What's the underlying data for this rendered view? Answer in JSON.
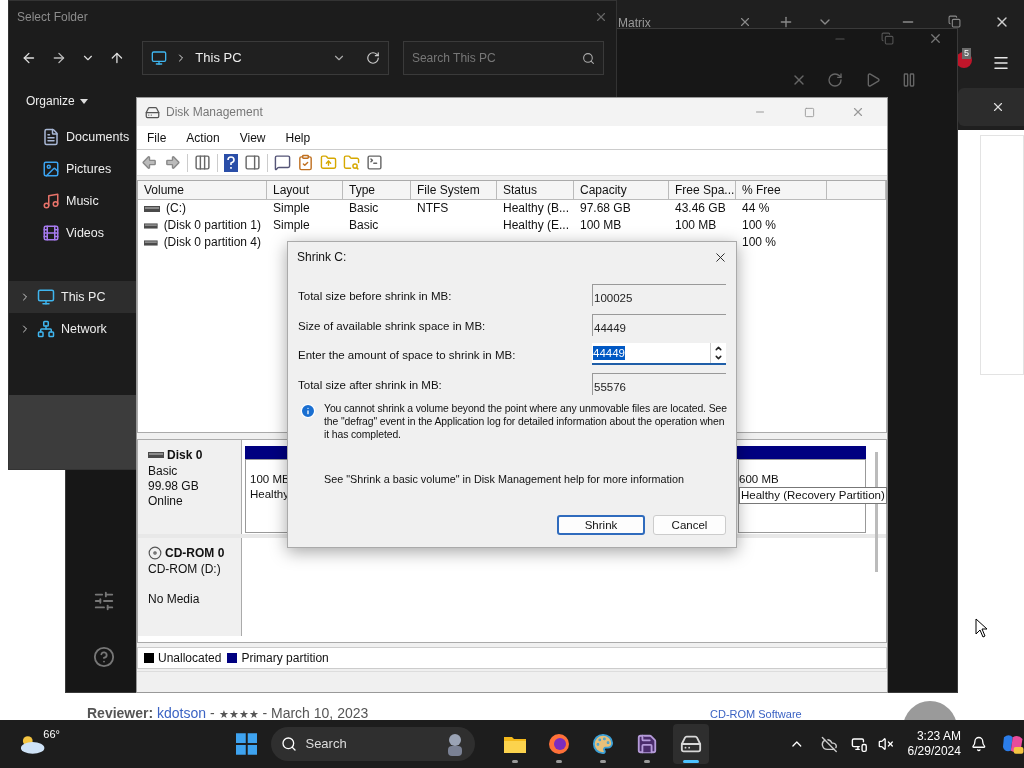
{
  "browser": {
    "tab_title": "Matrix",
    "badge": "5"
  },
  "select_folder": {
    "title": "Select Folder",
    "address": "This PC",
    "search_placeholder": "Search This PC",
    "organize": "Organize",
    "nav": [
      {
        "label": "Documents",
        "expandable": false,
        "selected": false
      },
      {
        "label": "Pictures",
        "expandable": false,
        "selected": false
      },
      {
        "label": "Music",
        "expandable": false,
        "selected": false
      },
      {
        "label": "Videos",
        "expandable": false,
        "selected": false
      },
      {
        "label": "This PC",
        "expandable": true,
        "selected": true
      },
      {
        "label": "Network",
        "expandable": true,
        "selected": false
      }
    ]
  },
  "disk_management": {
    "title": "Disk Management",
    "menu": [
      "File",
      "Action",
      "View",
      "Help"
    ],
    "columns": [
      "Volume",
      "Layout",
      "Type",
      "File System",
      "Status",
      "Capacity",
      "Free Spa...",
      "% Free"
    ],
    "rows": [
      [
        "(C:)",
        "Simple",
        "Basic",
        "NTFS",
        "Healthy (B...",
        "97.68 GB",
        "43.46 GB",
        "44 %"
      ],
      [
        "(Disk 0 partition 1)",
        "Simple",
        "Basic",
        "",
        "Healthy (E...",
        "100 MB",
        "100 MB",
        "100 %"
      ],
      [
        "(Disk 0 partition 4)",
        "",
        "",
        "",
        "",
        "",
        "",
        "100 %"
      ]
    ],
    "disks": [
      {
        "name": "Disk 0",
        "kind": "disk",
        "lines": [
          "Basic",
          "99.98 GB",
          "Online"
        ],
        "partitions": [
          {
            "size": "100 MB",
            "status": "Healthy"
          },
          {
            "size": "600 MB",
            "status": "Healthy (Recovery Partition)"
          }
        ]
      },
      {
        "name": "CD-ROM 0",
        "kind": "cdrom",
        "lines": [
          "CD-ROM (D:)",
          "No Media"
        ]
      }
    ],
    "legend": [
      {
        "label": "Unallocated",
        "color": "#000000"
      },
      {
        "label": "Primary partition",
        "color": "#000080"
      }
    ]
  },
  "dialog": {
    "title": "Shrink C:",
    "fields": [
      {
        "label": "Total size before shrink in MB:",
        "value": "100025",
        "kind": "readonly"
      },
      {
        "label": "Size of available shrink space in MB:",
        "value": "44449",
        "kind": "readonly"
      },
      {
        "label": "Enter the amount of space to shrink in MB:",
        "value": "44449",
        "kind": "spin",
        "text_selected": true
      },
      {
        "label": "Total size after shrink in MB:",
        "value": "55576",
        "kind": "readonly"
      }
    ],
    "info": "You cannot shrink a volume beyond the point where any unmovable files are located. See the \"defrag\" event in the Application log for detailed information about the operation when it has completed.",
    "help": "See \"Shrink a basic volume\" in Disk Management help for more information",
    "buttons": [
      {
        "label": "Shrink",
        "default": true
      },
      {
        "label": "Cancel",
        "default": false
      }
    ]
  },
  "page": {
    "reviewer_label": "Reviewer:",
    "reviewer": "kdotson",
    "separator": "-",
    "stars": 4,
    "date": "March 10, 2023",
    "side_link": "CD-ROM Software"
  },
  "taskbar": {
    "temperature": "66°",
    "search": "Search",
    "apps": [
      {
        "active": false
      },
      {
        "active": false
      },
      {
        "active": false
      },
      {
        "active": false
      },
      {
        "active": true
      }
    ],
    "time": "3:23 AM",
    "date": "6/29/2024"
  }
}
